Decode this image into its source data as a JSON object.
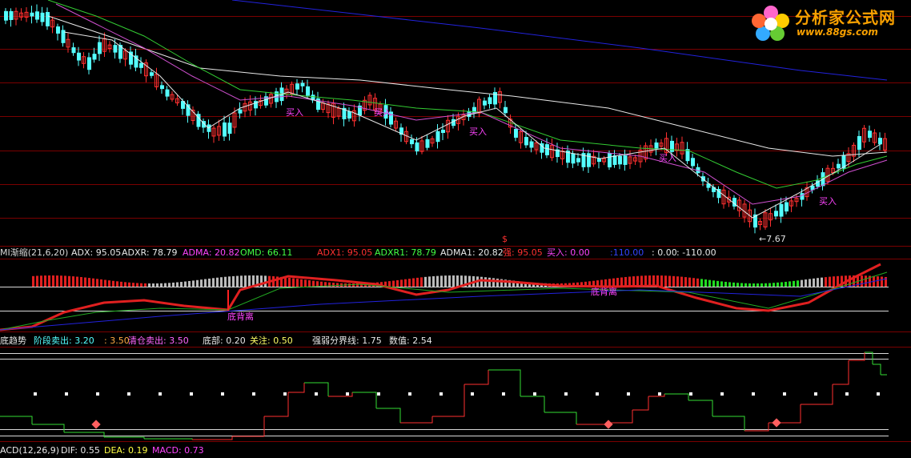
{
  "colors": {
    "background": "#000000",
    "candle_up": "#ff3030",
    "candle_down": "#54ffff",
    "ma_white": "#e8e8e8",
    "ma_magenta": "#d050d0",
    "ma_green": "#33cc33",
    "ma_blue": "#2222dd",
    "grid": "#7a0000",
    "signal_magenta": "#ff44ff"
  },
  "logo": {
    "title": "分析家公式网",
    "url": "www.88gs.com"
  },
  "main_panel": {
    "buy_labels": [
      "买入",
      "买入",
      "买入",
      "买入",
      "买入"
    ],
    "low_marker": "←7.67",
    "top_marker": "$"
  },
  "dmi_panel": {
    "title": "MI渐缩(21,6,20)",
    "adx": "ADX: 95.05",
    "adxr": "ADXR: 78.79",
    "adma": "ADMA: 20.82",
    "omd": "OMD: 66.11",
    "adx1": "ADX1: 95.05",
    "adxr1": "ADXR1: 78.79",
    "adma1": "ADMA1: 20.82",
    "strong": "强: 95.05",
    "buy": "买入: 0.00",
    "v1": ":110.00",
    "v2": ": 0.00",
    "v3": ": -110.00",
    "divergence_1": "底背离",
    "divergence_2": "底背离"
  },
  "trend_panel": {
    "title": "底趋势",
    "stage_sell": "阶段卖出: 3.20",
    "v350": ": 3.50",
    "clear_sell": "清仓卖出: 3.50",
    "bottom": "底部: 0.20",
    "watch": "关注: 0.50",
    "boundary": "强弱分界线: 1.75",
    "value": "数值: 2.54"
  },
  "macd_panel": {
    "title": "ACD(12,26,9)",
    "dif": "DIF: 0.55",
    "dea": "DEA: 0.19",
    "macd": "MACD: 0.73"
  }
}
